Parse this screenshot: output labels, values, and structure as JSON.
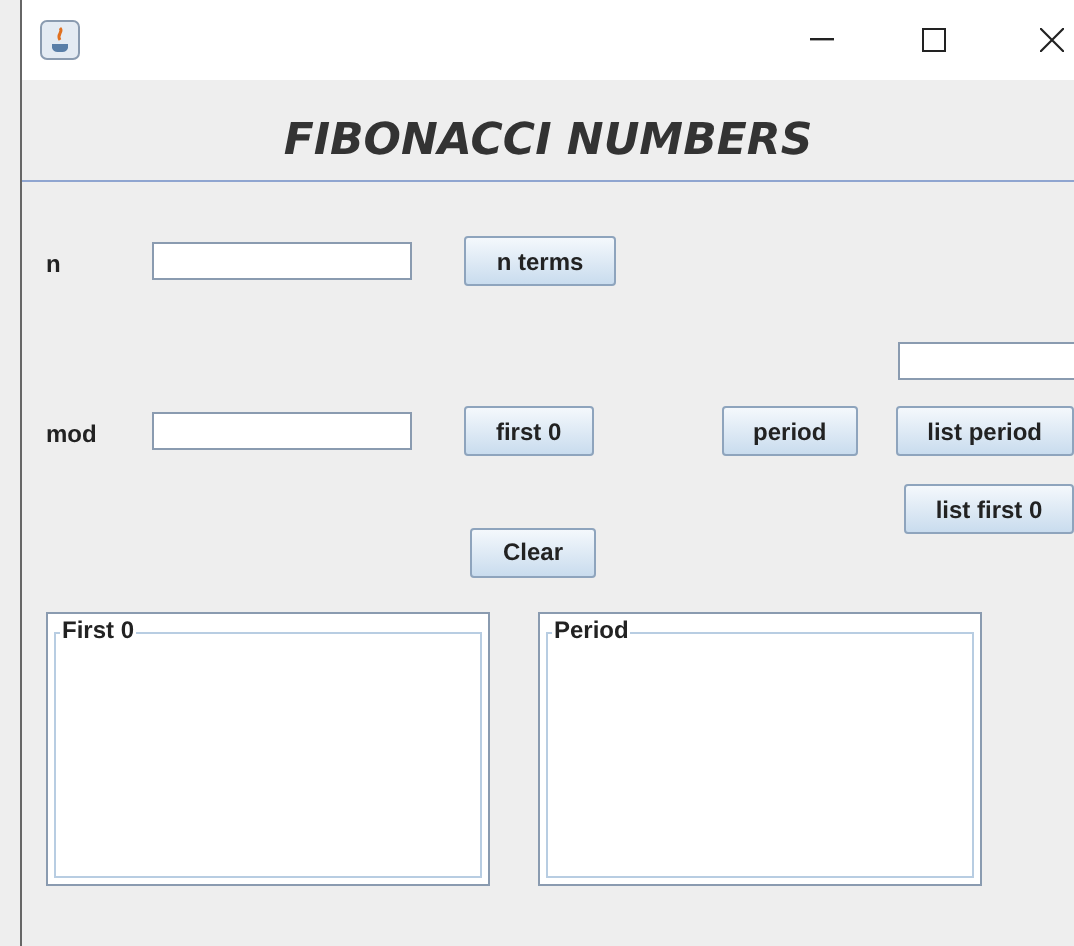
{
  "heading": "FIBONACCI NUMBERS",
  "n_row": {
    "label": "n",
    "button": "n terms"
  },
  "mod_row": {
    "label": "mod",
    "buttons": [
      "first 0",
      "period",
      "list period"
    ]
  },
  "list_first_button": "list first 0",
  "clear_button": "Clear",
  "panels": [
    {
      "title": "First 0"
    },
    {
      "title": "Period"
    }
  ]
}
